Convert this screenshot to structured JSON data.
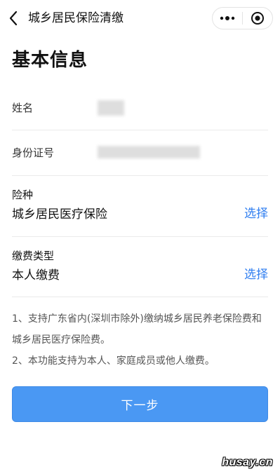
{
  "nav": {
    "title": "城乡居民保险清缴",
    "back_icon": "chevron-left-icon",
    "more_icon": "more-dots-icon",
    "close_icon": "target-circle-icon"
  },
  "page": {
    "title": "基本信息"
  },
  "fields": {
    "name_label": "姓名",
    "id_label": "身份证号"
  },
  "insurance": {
    "label": "险种",
    "value": "城乡居民医疗保险",
    "action": "选择"
  },
  "payment": {
    "label": "缴费类型",
    "value": "本人缴费",
    "action": "选择"
  },
  "notes": [
    "1、支持广东省内(深圳市除外)缴纳城乡居民养老保险费和城乡居民医疗保险费。",
    "2、本功能支持为本人、家庭成员或他人缴费。"
  ],
  "button": {
    "label": "下一步"
  },
  "watermark": "husay.cn",
  "colors": {
    "accent": "#2f7ef0",
    "button": "#4a98f3"
  }
}
